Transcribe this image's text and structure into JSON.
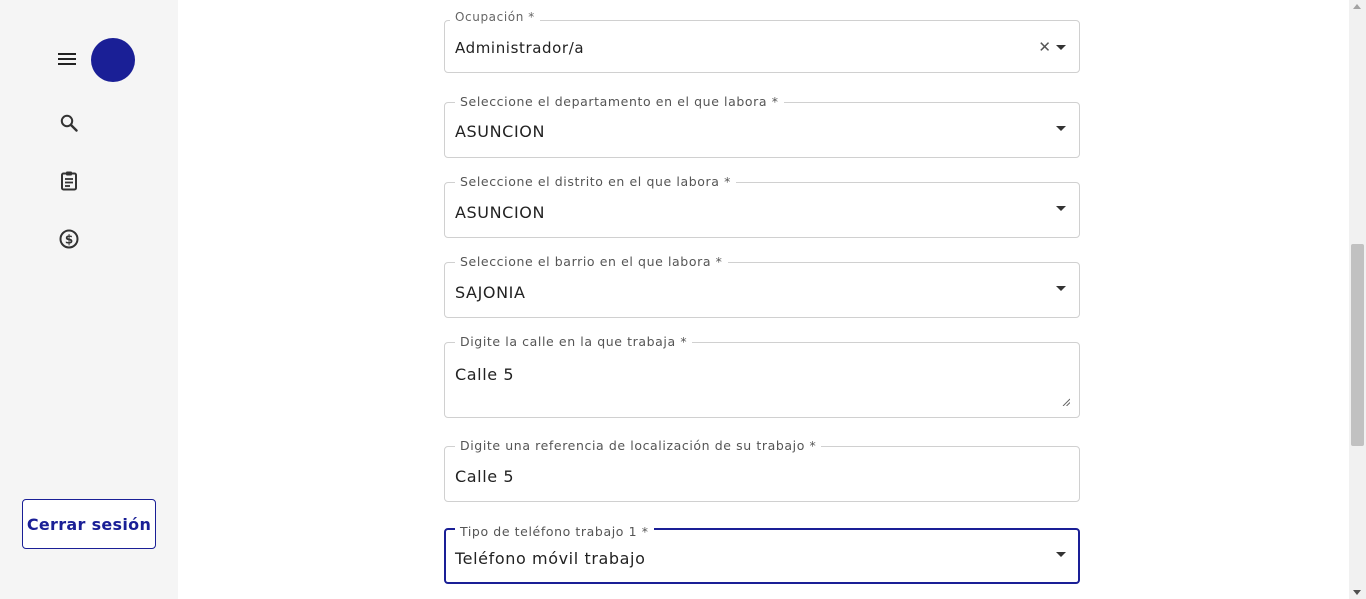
{
  "sidebar": {
    "menu_icon": "hamburger-menu-icon",
    "avatar_color": "#1a1f96",
    "icons": [
      "search-icon",
      "clipboard-icon",
      "dollar-circle-icon"
    ],
    "logout_label": "Cerrar sesión"
  },
  "form": {
    "ocupacion": {
      "label": "Ocupación *",
      "value": "Administrador/a"
    },
    "departamento": {
      "label": "Seleccione el departamento en el que labora *",
      "value": "ASUNCION"
    },
    "distrito": {
      "label": "Seleccione el distrito en el que labora *",
      "value": "ASUNCION"
    },
    "barrio": {
      "label": "Seleccione el barrio en el que labora *",
      "value": "SAJONIA"
    },
    "calle": {
      "label": "Digite la calle en la que trabaja *",
      "value": "Calle 5"
    },
    "referencia": {
      "label": "Digite una referencia de localización de su trabajo *",
      "value": "Calle 5"
    },
    "tipo_telefono": {
      "label": "Tipo de teléfono trabajo 1 *",
      "value": "Teléfono móvil trabajo"
    }
  },
  "colors": {
    "accent": "#1a1f96",
    "sidebar_bg": "#f5f5f5",
    "border": "#d0d0d0"
  }
}
